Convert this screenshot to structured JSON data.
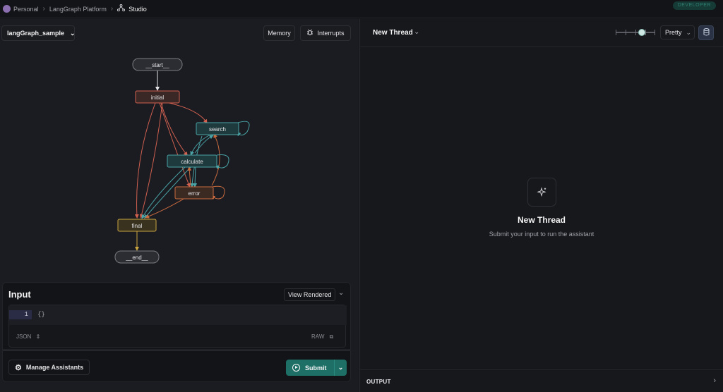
{
  "topbar": {
    "crumbs": [
      "Personal",
      "LangGraph Platform",
      "Studio"
    ],
    "badge": "DEVELOPER"
  },
  "graph_panel": {
    "graph_name": "langGraph_sample",
    "memory_label": "Memory",
    "interrupts_label": "Interrupts",
    "nodes": [
      {
        "id": "start",
        "label": "__start__"
      },
      {
        "id": "initial",
        "label": "initial"
      },
      {
        "id": "search",
        "label": "search"
      },
      {
        "id": "calculate",
        "label": "calculate"
      },
      {
        "id": "error",
        "label": "error"
      },
      {
        "id": "final",
        "label": "final"
      },
      {
        "id": "end",
        "label": "__end__"
      }
    ]
  },
  "input": {
    "title": "Input",
    "view_label": "View Rendered",
    "line_number": "1",
    "code": "{}",
    "format_label": "JSON",
    "raw_label": "RAW"
  },
  "footer": {
    "manage_label": "Manage Assistants",
    "submit_label": "Submit"
  },
  "thread": {
    "title": "New Thread",
    "view_mode": "Pretty",
    "empty_title": "New Thread",
    "empty_subtitle": "Submit your input to run the assistant",
    "output_label": "OUTPUT"
  },
  "colors": {
    "accent": "#1e6f66",
    "node_initial": "#d2604f",
    "node_search": "#4aa3a5",
    "node_error": "#c96a3e",
    "node_final": "#c9a43f"
  }
}
